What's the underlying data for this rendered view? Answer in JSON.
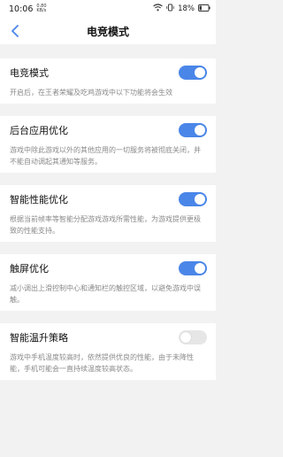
{
  "status_bar": {
    "time": "10:06",
    "net_speed_value": "0.80",
    "net_speed_unit": "KB/s",
    "battery": "18%"
  },
  "header": {
    "title": "电竞模式"
  },
  "settings": [
    {
      "title": "电竞模式",
      "desc": "开启后，在王者荣耀及吃鸡游戏中以下功能将会生效",
      "enabled": true
    },
    {
      "title": "后台应用优化",
      "desc": "游戏中除此游戏以外的其他应用的一切服务将被彻底关闭，并不能自动调起其通知等服务。",
      "enabled": true
    },
    {
      "title": "智能性能优化",
      "desc": "根据当前帧率等智能分配游戏游戏所需性能，为游戏提供更极致的性能支持。",
      "enabled": true
    },
    {
      "title": "触屏优化",
      "desc": "减小调出上滑控制中心和通知栏的触控区域，以避免游戏中误触。",
      "enabled": true
    },
    {
      "title": "智能温升策略",
      "desc": "游戏中手机温度较高时，依然提供优良的性能，由于未降性能，手机可能会一直持续温度较高状态。",
      "enabled": false
    }
  ],
  "colors": {
    "accent": "#4a86e8",
    "toggle_off": "#e6e6e6",
    "background": "#f2f2f2"
  }
}
